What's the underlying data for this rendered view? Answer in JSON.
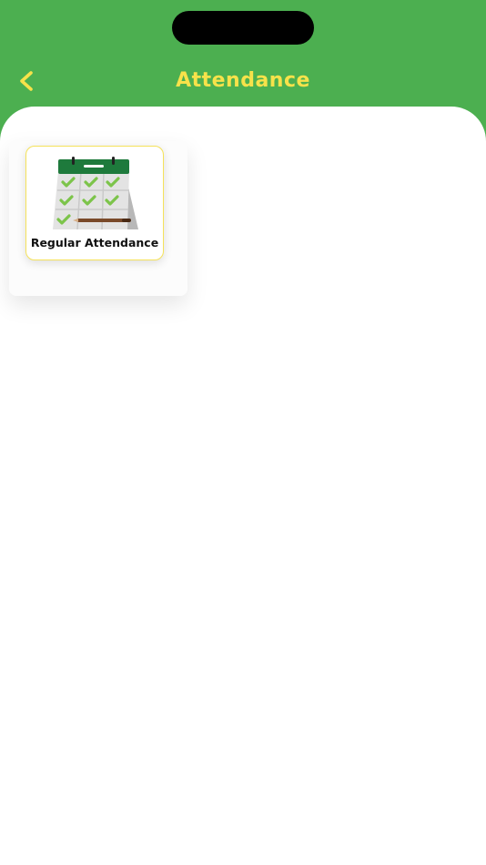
{
  "header": {
    "title": "Attendance",
    "back_icon": "chevron-left-icon"
  },
  "colors": {
    "header_bg": "#4caf50",
    "accent_yellow": "#f7e24a",
    "card_border": "#f5e25a",
    "calendar_green": "#1e7a3c",
    "check_green": "#7cc44a"
  },
  "tiles": [
    {
      "label": "Regular Attendance",
      "icon": "calendar-check-icon"
    }
  ]
}
